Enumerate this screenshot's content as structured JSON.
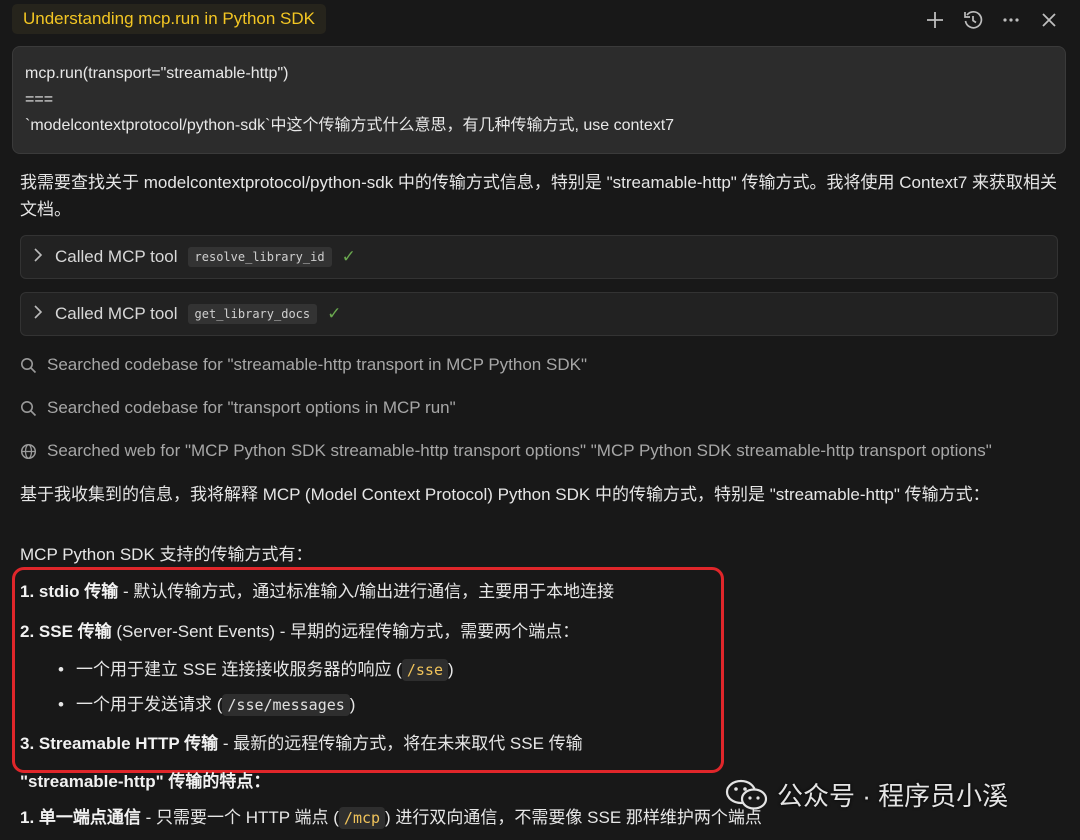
{
  "titlebar": {
    "title": "Understanding mcp.run in Python SDK",
    "icons": [
      "plus-icon",
      "history-icon",
      "more-icon",
      "close-icon"
    ]
  },
  "prompt": {
    "lines": [
      "mcp.run(transport=\"streamable-http\")",
      "===",
      "`modelcontextprotocol/python-sdk`中这个传输方式什么意思，有几种传输方式, use context7"
    ]
  },
  "intro": "我需要查找关于 modelcontextprotocol/python-sdk 中的传输方式信息，特别是 \"streamable-http\" 传输方式。我将使用 Context7 来获取相关文档。",
  "tool_calls": [
    {
      "label": "Called MCP tool",
      "tool": "resolve_library_id"
    },
    {
      "label": "Called MCP tool",
      "tool": "get_library_docs"
    }
  ],
  "searches": [
    {
      "icon": "search-icon",
      "text": "Searched codebase for \"streamable-http transport in MCP Python SDK\""
    },
    {
      "icon": "search-icon",
      "text": "Searched codebase for \"transport options in MCP run\""
    },
    {
      "icon": "globe-icon",
      "text": "Searched web for \"MCP Python SDK streamable-http transport options\" \"MCP Python SDK streamable-http transport options\""
    }
  ],
  "summary": "基于我收集到的信息，我将解释 MCP (Model Context Protocol) Python SDK 中的传输方式，特别是 \"streamable-http\" 传输方式：",
  "list_heading": "MCP Python SDK 支持的传输方式有：",
  "items": {
    "i1_bold": "1. stdio 传输",
    "i1_rest": " - 默认传输方式，通过标准输入/输出进行通信，主要用于本地连接",
    "i2_bold": "2. SSE 传输",
    "i2_rest": " (Server-Sent Events) - 早期的远程传输方式，需要两个端点：",
    "b1_pre": "一个用于建立 SSE 连接接收服务器的响应 (",
    "b1_code": "/sse",
    "b1_post": ")",
    "b2_pre": "一个用于发送请求 (",
    "b2_code": "/sse/messages",
    "b2_post": ")",
    "i3_bold": "3. Streamable HTTP 传输",
    "i3_rest": " - 最新的远程传输方式，将在未来取代 SSE 传输"
  },
  "features_heading": "\"streamable-http\" 传输的特点：",
  "feature1": {
    "bold": "1. 单一端点通信",
    "pre": " - 只需要一个 HTTP 端点 (",
    "code": "/mcp",
    "post": ") 进行双向通信，不需要像 SSE 那样维护两个端点"
  },
  "watermark": "公众号 · 程序员小溪",
  "colors": {
    "accent_title": "#f3c623",
    "highlight_box": "#e0262a",
    "check": "#6aa84f",
    "code_text": "#f0c35a"
  }
}
